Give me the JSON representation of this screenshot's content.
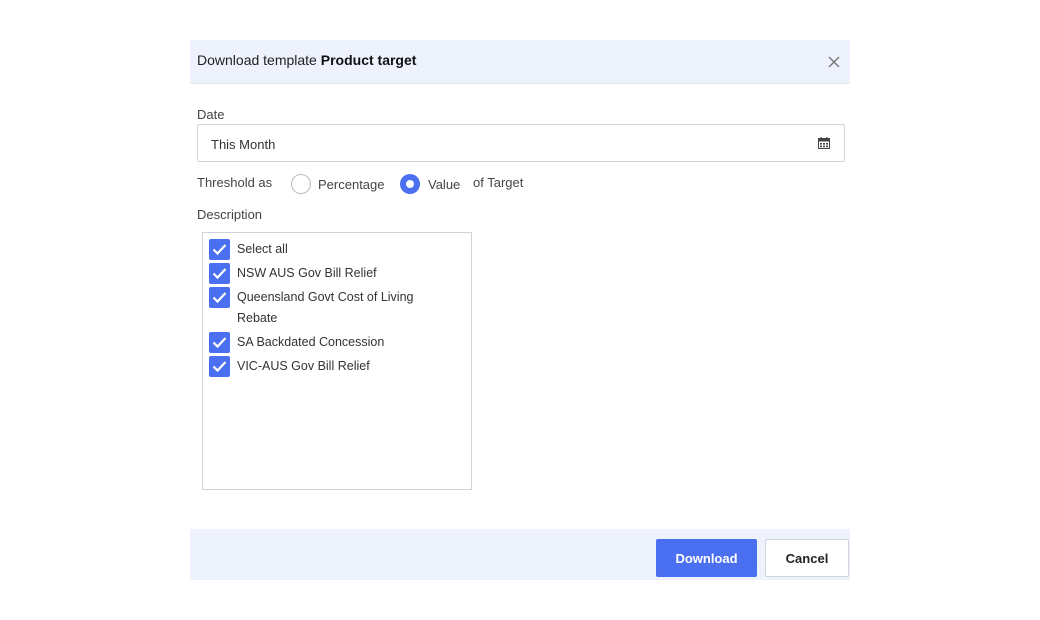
{
  "header": {
    "title_prefix": "Download template",
    "title_bold": "Product target"
  },
  "date": {
    "label": "Date",
    "value": "This Month"
  },
  "threshold": {
    "label": "Threshold as",
    "options": [
      {
        "label": "Percentage",
        "selected": false
      },
      {
        "label": "Value",
        "selected": true
      }
    ],
    "suffix": "of Target"
  },
  "description": {
    "label": "Description",
    "items": [
      {
        "label": "Select all",
        "checked": true
      },
      {
        "label": "NSW AUS Gov Bill Relief",
        "checked": true
      },
      {
        "label": "Queensland Govt Cost of Living Rebate",
        "checked": true
      },
      {
        "label": "SA Backdated Concession",
        "checked": true
      },
      {
        "label": "VIC-AUS Gov Bill Relief",
        "checked": true
      }
    ]
  },
  "footer": {
    "download_label": "Download",
    "cancel_label": "Cancel"
  },
  "colors": {
    "accent": "#4a6ff0",
    "header_bg": "#edf2fd"
  }
}
